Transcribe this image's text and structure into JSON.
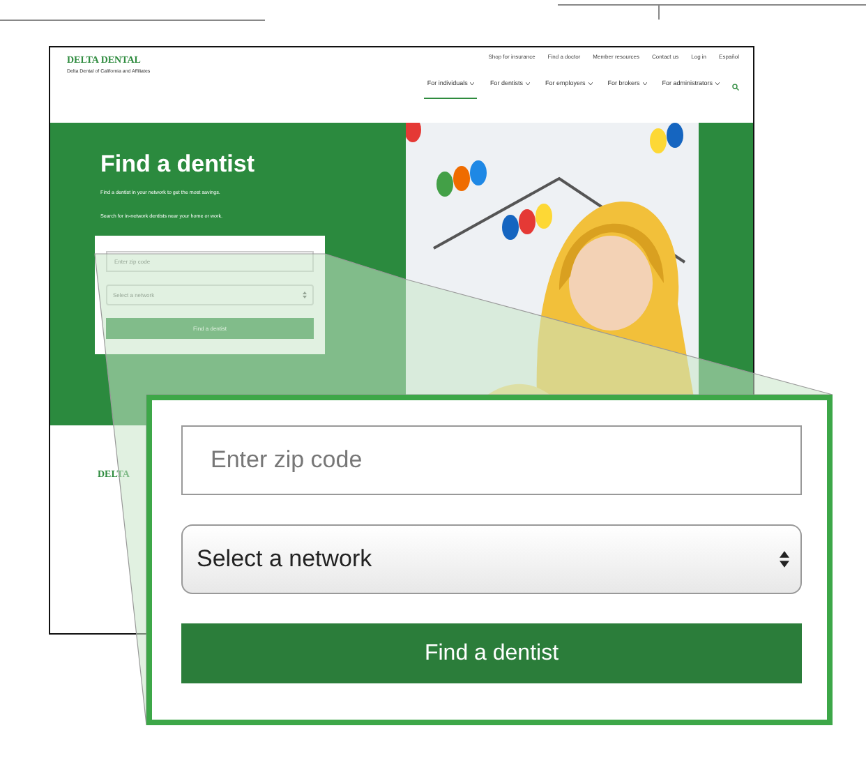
{
  "header": {
    "logo": "DELTA DENTAL",
    "tagline": "Delta Dental of California and Affiliates",
    "utility_links": [
      "Shop for insurance",
      "Find a doctor",
      "Member resources",
      "Contact us",
      "Log in",
      "Español"
    ],
    "nav": [
      {
        "label": "For individuals",
        "selected": true
      },
      {
        "label": "For dentists",
        "selected": false
      },
      {
        "label": "For employers",
        "selected": false
      },
      {
        "label": "For brokers",
        "selected": false
      },
      {
        "label": "For administrators",
        "selected": false
      }
    ]
  },
  "hero": {
    "title": "Find a dentist",
    "lines": [
      "Find a dentist in your network to get the most savings.",
      "Search for in-network dentists near your home or work."
    ],
    "form": {
      "zip_placeholder": "Enter zip code",
      "network": "Select a network",
      "button": "Find a dentist"
    }
  },
  "footer": {
    "logo": "DELTA"
  },
  "callout": {
    "zip_placeholder": "Enter zip code",
    "network": "Select a network",
    "button": "Find a dentist"
  }
}
